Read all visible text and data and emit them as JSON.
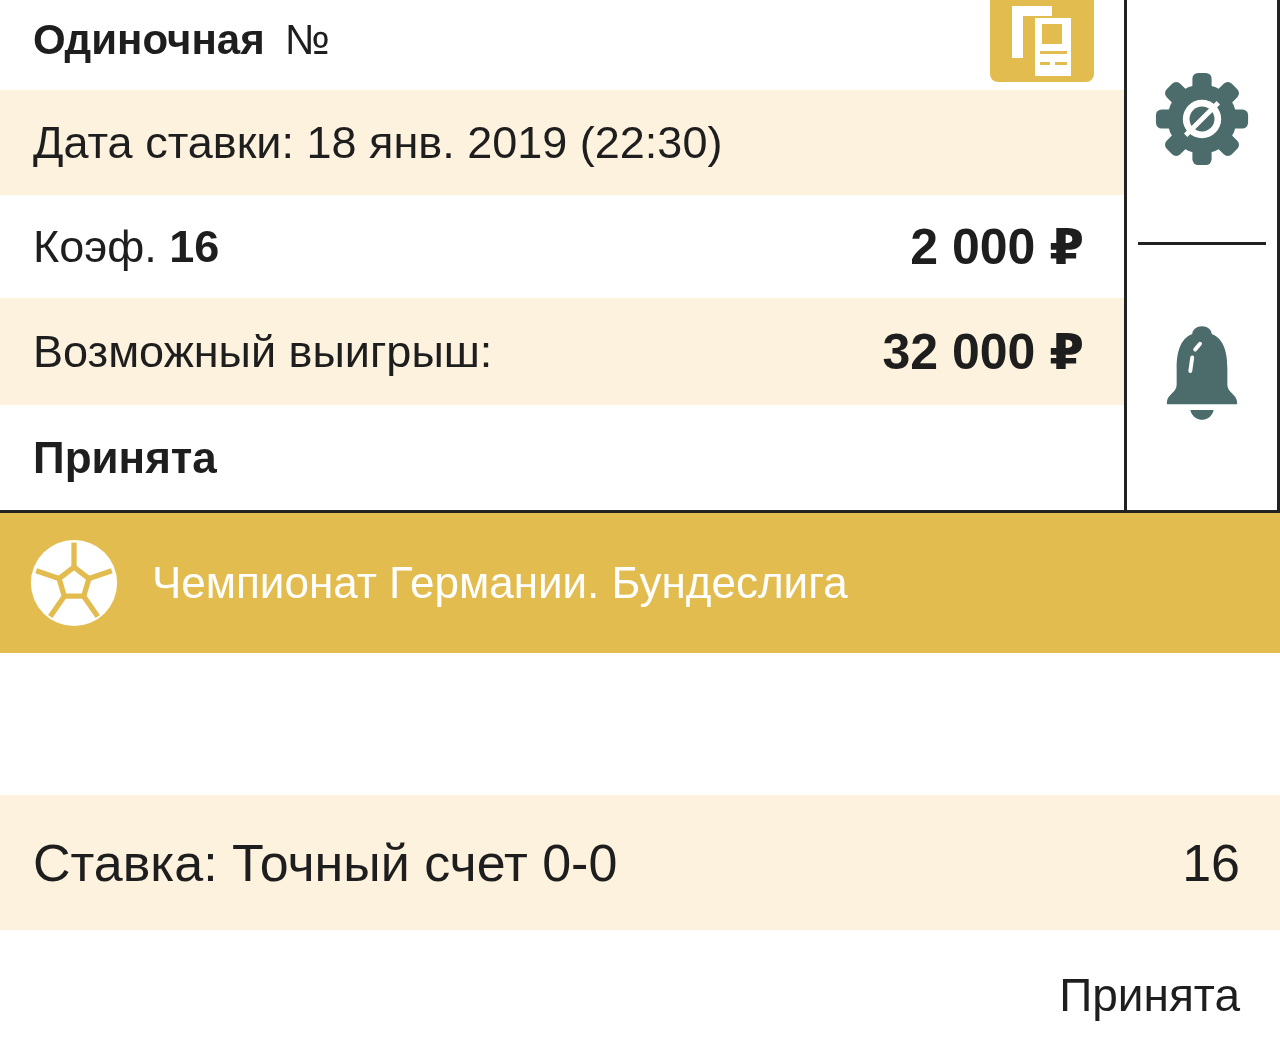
{
  "header": {
    "title": "Одиночная",
    "number_label": "№"
  },
  "details": [
    {
      "kind": "text",
      "label": "Дата ставки: 18 янв. 2019 (22:30)"
    },
    {
      "kind": "amount",
      "label": "Коэф. **16**",
      "amount": "2 000 ₽"
    },
    {
      "kind": "amount",
      "label": "Возможный выигрыш:",
      "amount": "32 000 ₽"
    },
    {
      "kind": "status",
      "label": "Принята"
    }
  ],
  "event": {
    "league": "Чемпионат Германии. Бундеслига",
    "selection": "Ставка: Точный счет 0-0",
    "odds": "16",
    "status": "Принята"
  }
}
